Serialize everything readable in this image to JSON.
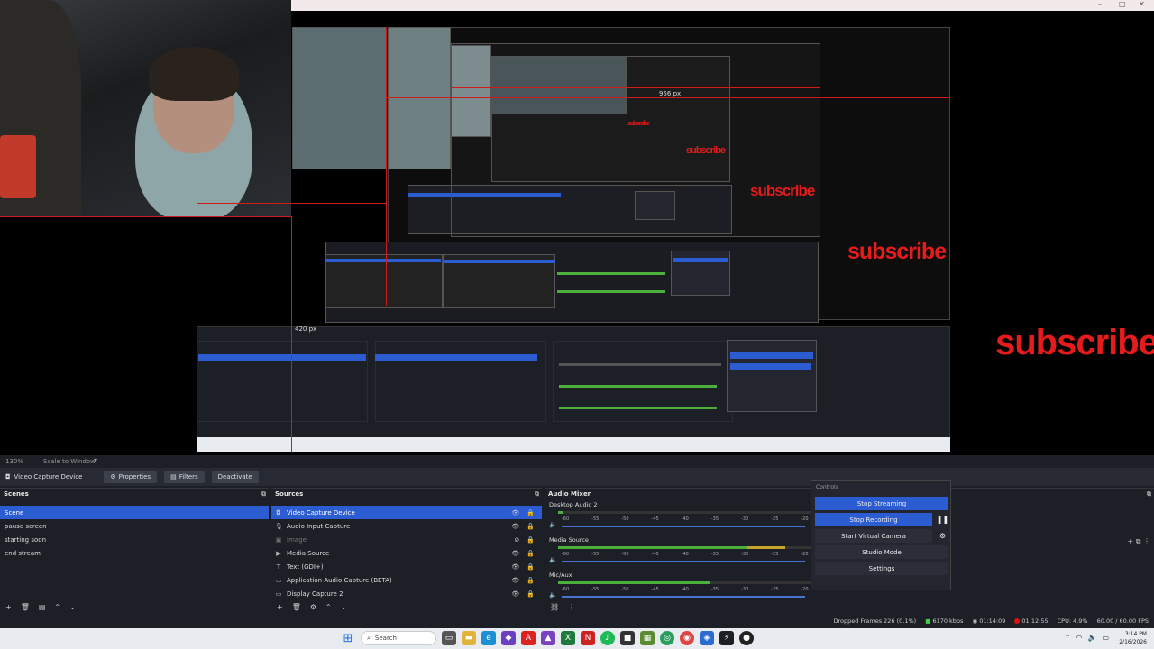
{
  "window": {
    "minimize_glyph": "–",
    "maximize_glyph": "□",
    "close_glyph": "✕"
  },
  "preview": {
    "label_956": "956 px",
    "label_420": "420 px",
    "subscribe_text": "subscribe"
  },
  "scale": {
    "zoom": "130%",
    "mode": "Scale to Window"
  },
  "toolbar": {
    "source_name": "Video Capture Device",
    "properties": "Properties",
    "filters": "Filters",
    "deactivate": "Deactivate"
  },
  "scenes": {
    "title": "Scenes",
    "items": [
      "Scene",
      "pause screen",
      "starting soon",
      "end stream"
    ],
    "selected_index": 0
  },
  "sources": {
    "title": "Sources",
    "items": [
      {
        "label": "Video Capture Device",
        "icon": "camera-icon"
      },
      {
        "label": "Audio Input Capture",
        "icon": "microphone-icon"
      },
      {
        "label": "Image",
        "icon": "image-icon"
      },
      {
        "label": "Media Source",
        "icon": "play-icon"
      },
      {
        "label": "Text (GDI+)",
        "icon": "text-icon"
      },
      {
        "label": "Application Audio Capture (BETA)",
        "icon": "app-audio-icon"
      },
      {
        "label": "Display Capture 2",
        "icon": "monitor-icon"
      }
    ]
  },
  "mixer": {
    "title": "Audio Mixer",
    "channels": [
      {
        "name": "Desktop Audio 2",
        "level": 0.02
      },
      {
        "name": "Media Source",
        "level": 0.9
      },
      {
        "name": "Mic/Aux",
        "level": 0.6
      }
    ],
    "ticks": [
      "-60",
      "-55",
      "-50",
      "-45",
      "-40",
      "-35",
      "-30",
      "-25",
      "-20",
      "-15",
      "-10",
      "-5"
    ]
  },
  "controls": {
    "title": "Controls",
    "stop_streaming": "Stop Streaming",
    "stop_recording": "Stop Recording",
    "start_virtual_camera": "Start Virtual Camera",
    "studio_mode": "Studio Mode",
    "settings": "Settings"
  },
  "status": {
    "dropped_frames": "Dropped Frames 226 (0.1%)",
    "bitrate": "6170 kbps",
    "stream_time": "01:14:09",
    "rec_time": "01:12:55",
    "cpu": "CPU: 4.9%",
    "fps": "60.00 / 60.00 FPS"
  },
  "taskbar": {
    "search_placeholder": "Search",
    "time": "3:14 PM",
    "date": "2/16/2026"
  },
  "colors": {
    "accent": "#2b5cd1",
    "record_red": "#d11a1a",
    "meter_green": "#4caf3c"
  }
}
